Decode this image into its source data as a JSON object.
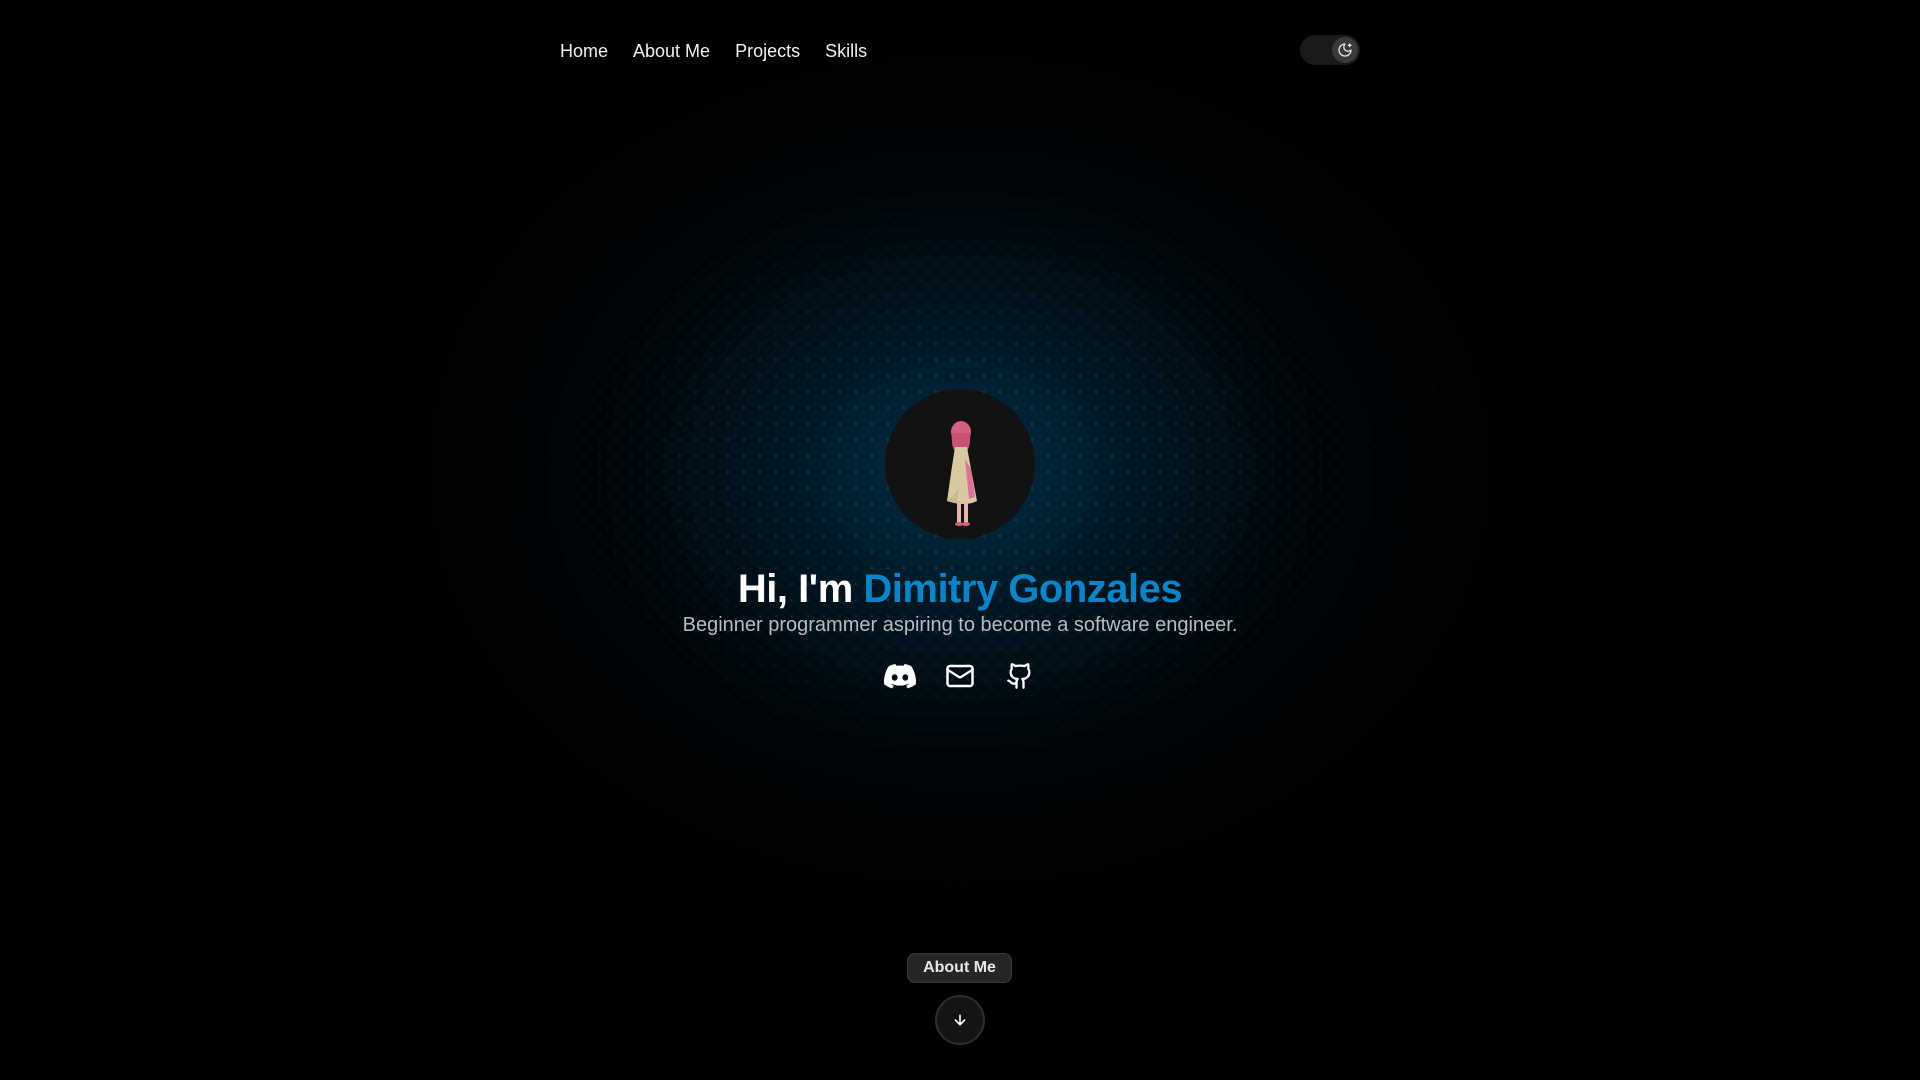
{
  "nav": {
    "items": [
      {
        "label": "Home"
      },
      {
        "label": "About Me"
      },
      {
        "label": "Projects"
      },
      {
        "label": "Skills"
      }
    ]
  },
  "theme_toggle": {
    "icon": "moon-icon"
  },
  "hero": {
    "greeting": "Hi, I'm ",
    "name": "Dimitry Gonzales",
    "subtitle": "Beginner programmer aspiring to become a software engineer.",
    "socials": [
      {
        "icon": "discord-icon"
      },
      {
        "icon": "mail-icon"
      },
      {
        "icon": "github-icon"
      }
    ]
  },
  "scroll": {
    "label": "About Me",
    "icon": "arrow-down-icon"
  },
  "colors": {
    "accent": "#0a84c9",
    "background": "#000000",
    "glow": "#00587f"
  }
}
